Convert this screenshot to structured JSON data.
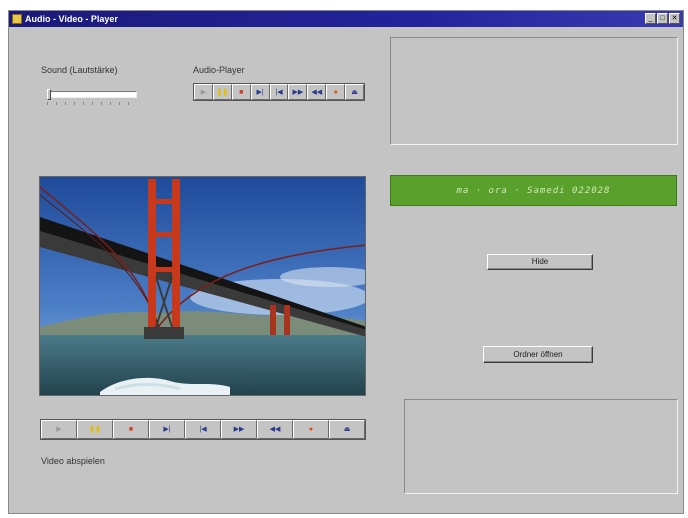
{
  "window": {
    "title": "Audio - Video - Player"
  },
  "title_buttons": {
    "minimize": "_",
    "maximize": "□",
    "close": "✕"
  },
  "volume": {
    "label": "Sound (Lautstärke)",
    "level": 0.0
  },
  "audio": {
    "label": "Audio-Player",
    "buttons": [
      {
        "name": "play-icon",
        "glyph": "▶"
      },
      {
        "name": "pause-icon",
        "glyph": "❚❚"
      },
      {
        "name": "stop-icon",
        "glyph": "■"
      },
      {
        "name": "step-icon",
        "glyph": "▶|"
      },
      {
        "name": "prev-icon",
        "glyph": "|◀"
      },
      {
        "name": "next-icon",
        "glyph": "▶▶"
      },
      {
        "name": "rewind-icon",
        "glyph": "◀◀"
      },
      {
        "name": "record-icon",
        "glyph": "●"
      },
      {
        "name": "eject-icon",
        "glyph": "⏏"
      }
    ]
  },
  "led": {
    "text": "ma · ora · Samedi 022028"
  },
  "buttons": {
    "first": "Hide",
    "second": "Ordner öffnen"
  },
  "video": {
    "label": "Video abspielen",
    "buttons": [
      {
        "name": "play-icon",
        "glyph": "▶"
      },
      {
        "name": "pause-icon",
        "glyph": "❚❚"
      },
      {
        "name": "stop-icon",
        "glyph": "■"
      },
      {
        "name": "step-icon",
        "glyph": "▶|"
      },
      {
        "name": "prev-icon",
        "glyph": "|◀"
      },
      {
        "name": "next-icon",
        "glyph": "▶▶"
      },
      {
        "name": "rewind-icon",
        "glyph": "◀◀"
      },
      {
        "name": "record-icon",
        "glyph": "●"
      },
      {
        "name": "eject-icon",
        "glyph": "⏏"
      }
    ]
  },
  "colors": {
    "titlebar": "#1a1a7a",
    "window": "#c4c4c4",
    "led": "#5aa02c",
    "led_text": "#cfeab6"
  }
}
